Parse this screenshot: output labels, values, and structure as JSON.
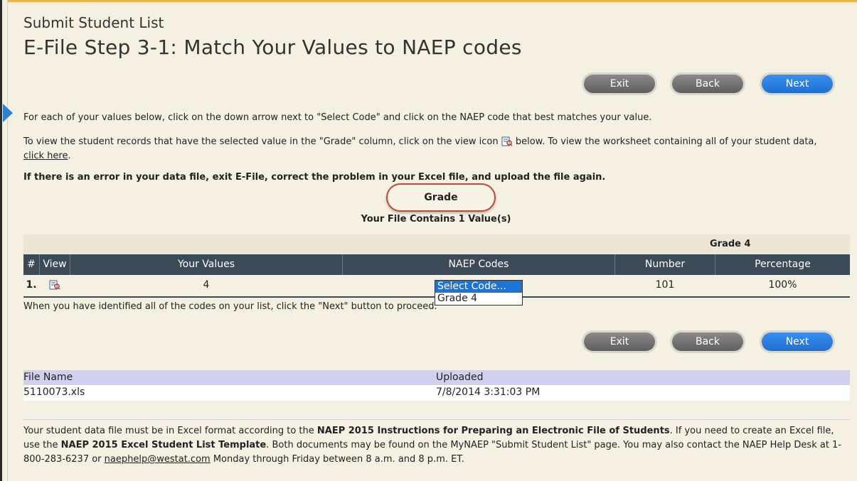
{
  "header": {
    "subtitle": "Submit Student List",
    "title": "E-File Step 3-1: Match Your Values to NAEP codes"
  },
  "buttons": {
    "exit": "Exit",
    "back": "Back",
    "next": "Next"
  },
  "instructions": {
    "line1": "For each of your values below, click on the down arrow next to \"Select Code\" and click on the NAEP code that best matches your value.",
    "line2_a": "To view the student records that have the selected value in the \"Grade\" column, click on the view icon",
    "line2_b": "below. To view the worksheet containing all of your student data,",
    "line2_link": "click here",
    "line2_end": ".",
    "error_note": "If there is an error in your data file, exit E-File, correct the problem in your Excel file, and upload the file again."
  },
  "column_pill": "Grade",
  "contains_text": "Your File Contains 1 Value(s)",
  "table": {
    "grade_group": "Grade 4",
    "headers": {
      "num": "#",
      "view": "View",
      "values": "Your Values",
      "codes": "NAEP Codes",
      "number": "Number",
      "pct": "Percentage"
    },
    "rows": [
      {
        "num": "1.",
        "value": "4",
        "number": "101",
        "pct": "100%"
      }
    ]
  },
  "dropdown": {
    "options": [
      "Select Code...",
      "Grade 4"
    ],
    "selected": "Select Code..."
  },
  "after_table": "When you have identified all of the codes on your list, click the \"Next\" button to proceed.",
  "file": {
    "name_label": "File Name",
    "uploaded_label": "Uploaded",
    "name": "5110073.xls",
    "uploaded": "7/8/2014 3:31:03 PM"
  },
  "footer": {
    "a": "Your student data file must be in Excel format according to the",
    "b_bold": "NAEP 2015 Instructions for Preparing an Electronic File of Students",
    "c": ". If you need to create an Excel file, use the",
    "d_bold": "NAEP 2015 Excel Student List Template",
    "e": ". Both documents may be found on the MyNAEP \"Submit Student List\" page. You may also contact the NAEP Help Desk at 1-800-283-6237 or",
    "email": "naephelp@westat.com",
    "f": "Monday through Friday between 8 a.m. and 8 p.m. ET."
  },
  "colors": {
    "accent_blue": "#1f6fd0",
    "header_dark": "#3c4a58",
    "pill_border": "#c04a38",
    "file_header": "#d1d0ef"
  }
}
